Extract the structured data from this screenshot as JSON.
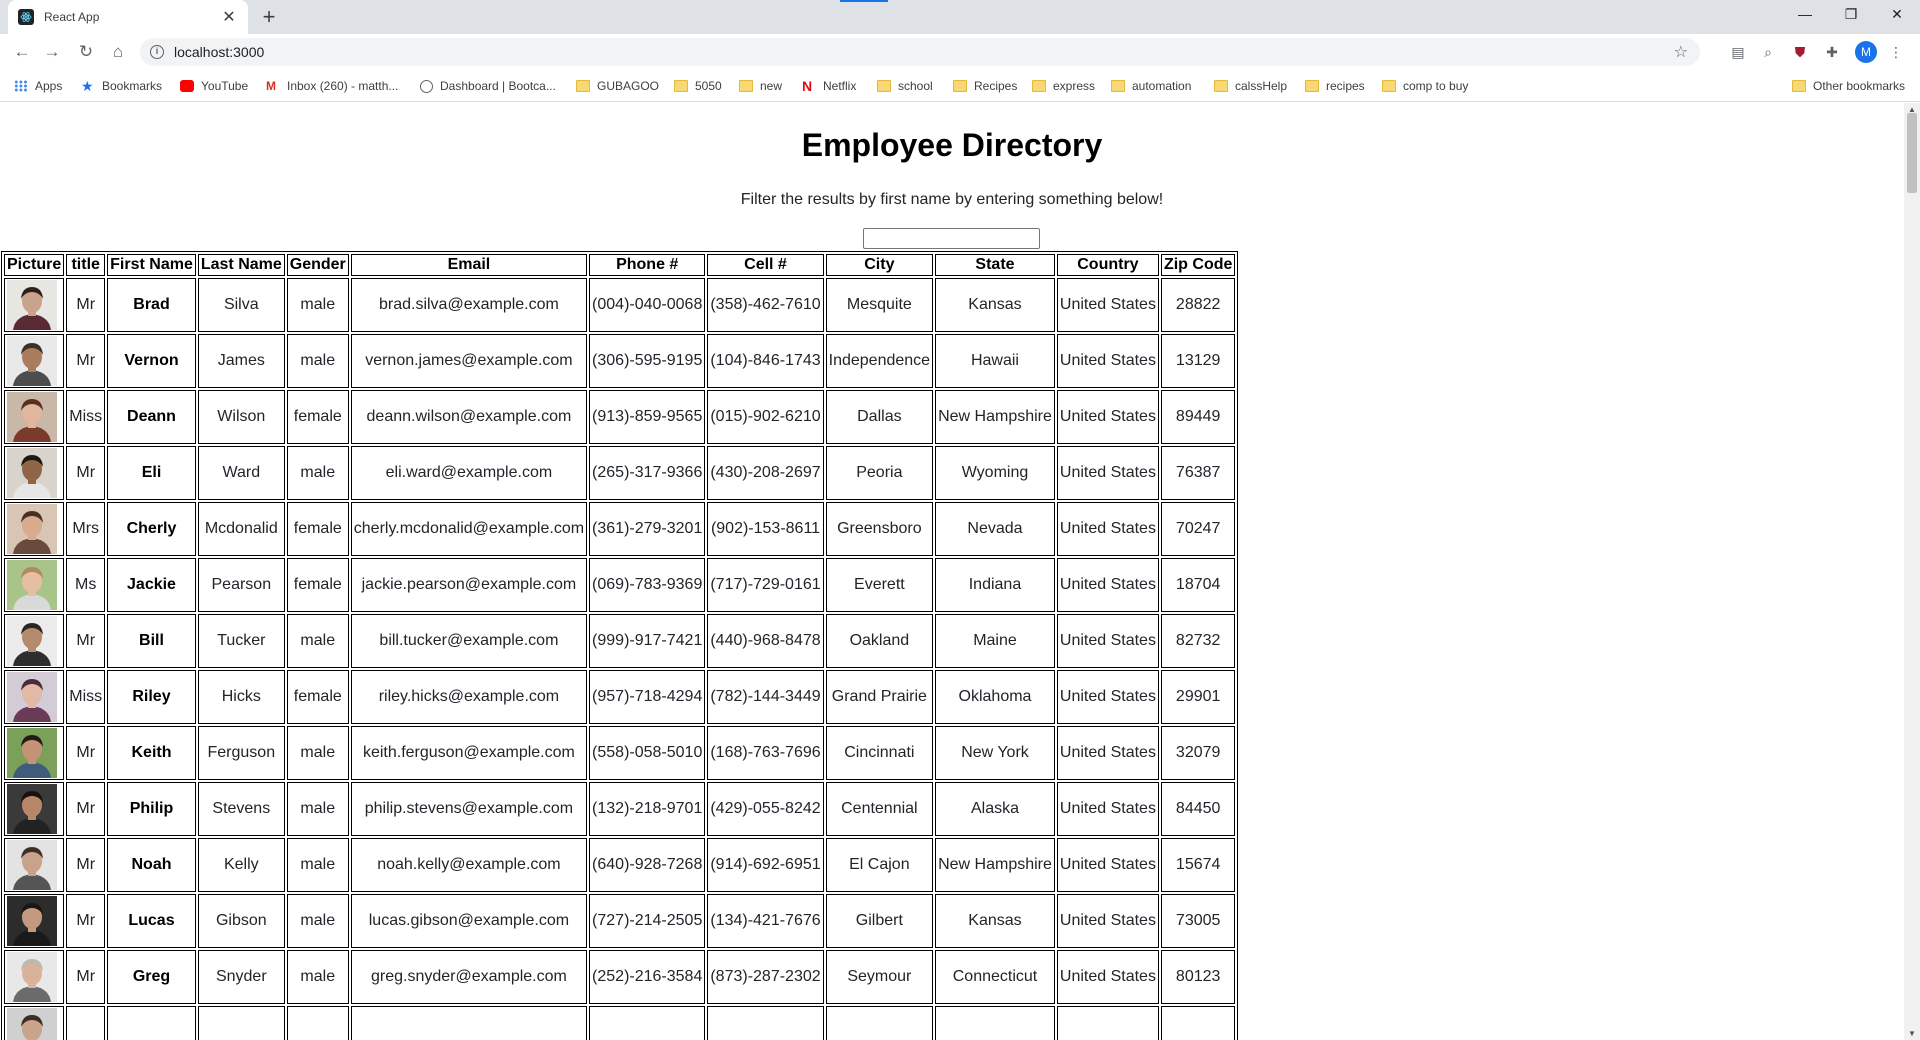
{
  "browser": {
    "tab_title": "React App",
    "url": "localhost:3000",
    "avatar_letter": "M",
    "bookmarks": [
      {
        "label": "Apps",
        "icon": "apps-grid-icon"
      },
      {
        "label": "Bookmarks",
        "icon": "star-icon"
      },
      {
        "label": "YouTube",
        "icon": "youtube-icon"
      },
      {
        "label": "Inbox (260) - matth...",
        "icon": "gmail-icon"
      },
      {
        "label": "Dashboard | Bootca...",
        "icon": "globe-icon"
      },
      {
        "label": "GUBAGOO",
        "icon": "folder-icon"
      },
      {
        "label": "5050",
        "icon": "folder-icon"
      },
      {
        "label": "new",
        "icon": "folder-icon"
      },
      {
        "label": "Netflix",
        "icon": "netflix-icon"
      },
      {
        "label": "school",
        "icon": "folder-icon"
      },
      {
        "label": "Recipes",
        "icon": "folder-icon"
      },
      {
        "label": "express",
        "icon": "folder-icon"
      },
      {
        "label": "automation",
        "icon": "folder-icon"
      },
      {
        "label": "calssHelp",
        "icon": "folder-icon"
      },
      {
        "label": "recipes",
        "icon": "folder-icon"
      },
      {
        "label": "comp to buy",
        "icon": "folder-icon"
      }
    ],
    "other_bookmarks": "Other bookmarks"
  },
  "page": {
    "title": "Employee Directory",
    "subtitle": "Filter the results by first name by entering something below!",
    "filter_value": ""
  },
  "table": {
    "headers": [
      "Picture",
      "title",
      "First Name",
      "Last Name",
      "Gender",
      "Email",
      "Phone #",
      "Cell #",
      "City",
      "State",
      "Country",
      "Zip Code"
    ],
    "rows": [
      {
        "title": "Mr",
        "first": "Brad",
        "last": "Silva",
        "gender": "male",
        "email": "brad.silva@example.com",
        "phone": "(004)-040-0068",
        "cell": "(358)-462-7610",
        "city": "Mesquite",
        "state": "Kansas",
        "country": "United States",
        "zip": "28822",
        "photo_bg": "#e8e6e3",
        "photo_skin": "#c9a38a",
        "photo_hair": "#2b2118",
        "photo_shirt": "#5a2a35"
      },
      {
        "title": "Mr",
        "first": "Vernon",
        "last": "James",
        "gender": "male",
        "email": "vernon.james@example.com",
        "phone": "(306)-595-9195",
        "cell": "(104)-846-1743",
        "city": "Independence",
        "state": "Hawaii",
        "country": "United States",
        "zip": "13129",
        "photo_bg": "#e9e9e9",
        "photo_skin": "#a97c5e",
        "photo_hair": "#3a2e26",
        "photo_shirt": "#4d4d4d"
      },
      {
        "title": "Miss",
        "first": "Deann",
        "last": "Wilson",
        "gender": "female",
        "email": "deann.wilson@example.com",
        "phone": "(913)-859-9565",
        "cell": "(015)-902-6210",
        "city": "Dallas",
        "state": "New Hampshire",
        "country": "United States",
        "zip": "89449",
        "photo_bg": "#c9b7a8",
        "photo_skin": "#e0b79c",
        "photo_hair": "#5a2e1e",
        "photo_shirt": "#7a3b2d"
      },
      {
        "title": "Mr",
        "first": "Eli",
        "last": "Ward",
        "gender": "male",
        "email": "eli.ward@example.com",
        "phone": "(265)-317-9366",
        "cell": "(430)-208-2697",
        "city": "Peoria",
        "state": "Wyoming",
        "country": "United States",
        "zip": "76387",
        "photo_bg": "#d8d4cc",
        "photo_skin": "#8f6447",
        "photo_hair": "#1c1814",
        "photo_shirt": "#e6e6e6"
      },
      {
        "title": "Mrs",
        "first": "Cherly",
        "last": "Mcdonalid",
        "gender": "female",
        "email": "cherly.mcdonalid@example.com",
        "phone": "(361)-279-3201",
        "cell": "(902)-153-8611",
        "city": "Greensboro",
        "state": "Nevada",
        "country": "United States",
        "zip": "70247",
        "photo_bg": "#d9c5b4",
        "photo_skin": "#d7ab8d",
        "photo_hair": "#4a2f22",
        "photo_shirt": "#6b4a3e"
      },
      {
        "title": "Ms",
        "first": "Jackie",
        "last": "Pearson",
        "gender": "female",
        "email": "jackie.pearson@example.com",
        "phone": "(069)-783-9369",
        "cell": "(717)-729-0161",
        "city": "Everett",
        "state": "Indiana",
        "country": "United States",
        "zip": "18704",
        "photo_bg": "#a9c488",
        "photo_skin": "#e6bfa2",
        "photo_hair": "#b48a5a",
        "photo_shirt": "#d9d9d9"
      },
      {
        "title": "Mr",
        "first": "Bill",
        "last": "Tucker",
        "gender": "male",
        "email": "bill.tucker@example.com",
        "phone": "(999)-917-7421",
        "cell": "(440)-968-8478",
        "city": "Oakland",
        "state": "Maine",
        "country": "United States",
        "zip": "82732",
        "photo_bg": "#ececec",
        "photo_skin": "#b58b6e",
        "photo_hair": "#2b2622",
        "photo_shirt": "#2e2e2e"
      },
      {
        "title": "Miss",
        "first": "Riley",
        "last": "Hicks",
        "gender": "female",
        "email": "riley.hicks@example.com",
        "phone": "(957)-718-4294",
        "cell": "(782)-144-3449",
        "city": "Grand Prairie",
        "state": "Oklahoma",
        "country": "United States",
        "zip": "29901",
        "photo_bg": "#d3cbd6",
        "photo_skin": "#e2b9a5",
        "photo_hair": "#4b2a3a",
        "photo_shirt": "#6a3b57"
      },
      {
        "title": "Mr",
        "first": "Keith",
        "last": "Ferguson",
        "gender": "male",
        "email": "keith.ferguson@example.com",
        "phone": "(558)-058-5010",
        "cell": "(168)-763-7696",
        "city": "Cincinnati",
        "state": "New York",
        "country": "United States",
        "zip": "32079",
        "photo_bg": "#7aa05a",
        "photo_skin": "#c49377",
        "photo_hair": "#221a14",
        "photo_shirt": "#3f5c7a"
      },
      {
        "title": "Mr",
        "first": "Philip",
        "last": "Stevens",
        "gender": "male",
        "email": "philip.stevens@example.com",
        "phone": "(132)-218-9701",
        "cell": "(429)-055-8242",
        "city": "Centennial",
        "state": "Alaska",
        "country": "United States",
        "zip": "84450",
        "photo_bg": "#3a3a3a",
        "photo_skin": "#b88668",
        "photo_hair": "#161210",
        "photo_shirt": "#222222"
      },
      {
        "title": "Mr",
        "first": "Noah",
        "last": "Kelly",
        "gender": "male",
        "email": "noah.kelly@example.com",
        "phone": "(640)-928-7268",
        "cell": "(914)-692-6951",
        "city": "El Cajon",
        "state": "New Hampshire",
        "country": "United States",
        "zip": "15674",
        "photo_bg": "#e3e3e3",
        "photo_skin": "#c8a28a",
        "photo_hair": "#3b2f27",
        "photo_shirt": "#555555"
      },
      {
        "title": "Mr",
        "first": "Lucas",
        "last": "Gibson",
        "gender": "male",
        "email": "lucas.gibson@example.com",
        "phone": "(727)-214-2505",
        "cell": "(134)-421-7676",
        "city": "Gilbert",
        "state": "Kansas",
        "country": "United States",
        "zip": "73005",
        "photo_bg": "#2c2c2c",
        "photo_skin": "#c29a80",
        "photo_hair": "#1c1613",
        "photo_shirt": "#1a1a1a"
      },
      {
        "title": "Mr",
        "first": "Greg",
        "last": "Snyder",
        "gender": "male",
        "email": "greg.snyder@example.com",
        "phone": "(252)-216-3584",
        "cell": "(873)-287-2302",
        "city": "Seymour",
        "state": "Connecticut",
        "country": "United States",
        "zip": "80123",
        "photo_bg": "#e8e8e8",
        "photo_skin": "#d9b29a",
        "photo_hair": "#bfb6ad",
        "photo_shirt": "#6b6b6b"
      },
      {
        "title": "",
        "first": "",
        "last": "",
        "gender": "",
        "email": "",
        "phone": "",
        "cell": "",
        "city": "",
        "state": "",
        "country": "",
        "zip": "",
        "photo_bg": "#d0d0d0",
        "photo_skin": "#c9a38a",
        "photo_hair": "#3a2e26",
        "photo_shirt": "#555555"
      }
    ]
  }
}
